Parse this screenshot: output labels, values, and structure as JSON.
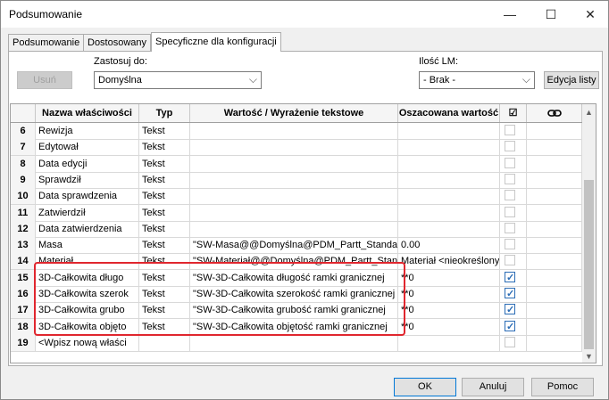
{
  "window": {
    "title": "Podsumowanie",
    "minimize": "—",
    "maximize": "☐",
    "close": "✕"
  },
  "tabs": [
    {
      "label": "Podsumowanie"
    },
    {
      "label": "Dostosowany"
    },
    {
      "label": "Specyficzne dla konfiguracji"
    }
  ],
  "toolbar": {
    "delete_label": "Usuń",
    "apply_to_label": "Zastosuj do:",
    "apply_to_value": "Domyślna",
    "bom_qty_label": "Ilość LM:",
    "bom_qty_value": "- Brak -",
    "edit_list_label": "Edycja listy"
  },
  "grid": {
    "headers": {
      "num": "",
      "name": "Nazwa właściwości",
      "type": "Typ",
      "value": "Wartość / Wyrażenie tekstowe",
      "evaluated": "Oszacowana wartość",
      "check": "☑"
    },
    "rows": [
      {
        "num": "6",
        "name": "Rewizja",
        "type": "Tekst",
        "value": "",
        "evaluated": "",
        "checked": false
      },
      {
        "num": "7",
        "name": "Edytował",
        "type": "Tekst",
        "value": "",
        "evaluated": "",
        "checked": false
      },
      {
        "num": "8",
        "name": "Data edycji",
        "type": "Tekst",
        "value": "",
        "evaluated": "",
        "checked": false
      },
      {
        "num": "9",
        "name": "Sprawdził",
        "type": "Tekst",
        "value": "",
        "evaluated": "",
        "checked": false
      },
      {
        "num": "10",
        "name": "Data sprawdzenia",
        "type": "Tekst",
        "value": "",
        "evaluated": "",
        "checked": false
      },
      {
        "num": "11",
        "name": "Zatwierdził",
        "type": "Tekst",
        "value": "",
        "evaluated": "",
        "checked": false
      },
      {
        "num": "12",
        "name": "Data zatwierdzenia",
        "type": "Tekst",
        "value": "",
        "evaluated": "",
        "checked": false
      },
      {
        "num": "13",
        "name": "Masa",
        "type": "Tekst",
        "value": "\"SW-Masa@@Domyślna@PDM_Partt_Standar",
        "evaluated": "0.00",
        "checked": false
      },
      {
        "num": "14",
        "name": "Materiał",
        "type": "Tekst",
        "value": "\"SW-Materiał@@Domyślna@PDM_Partt_Stan",
        "evaluated": "Materiał <nieokreślony",
        "checked": false
      },
      {
        "num": "15",
        "name": "3D-Całkowita długo",
        "type": "Tekst",
        "value": "\"SW-3D-Całkowita długość ramki granicznej",
        "evaluated": "**0",
        "checked": true
      },
      {
        "num": "16",
        "name": "3D-Całkowita szerok",
        "type": "Tekst",
        "value": "\"SW-3D-Całkowita szerokość ramki granicznej",
        "evaluated": "**0",
        "checked": true
      },
      {
        "num": "17",
        "name": "3D-Całkowita grubo",
        "type": "Tekst",
        "value": "\"SW-3D-Całkowita grubość ramki granicznej",
        "evaluated": "**0",
        "checked": true
      },
      {
        "num": "18",
        "name": "3D-Całkowita objęto",
        "type": "Tekst",
        "value": "\"SW-3D-Całkowita objętość ramki granicznej",
        "evaluated": "**0",
        "checked": true
      },
      {
        "num": "19",
        "name": "<Wpisz nową właści",
        "type": "",
        "value": "",
        "evaluated": "",
        "checked": false
      }
    ]
  },
  "footer": {
    "ok_label": "OK",
    "cancel_label": "Anuluj",
    "help_label": "Pomoc"
  }
}
